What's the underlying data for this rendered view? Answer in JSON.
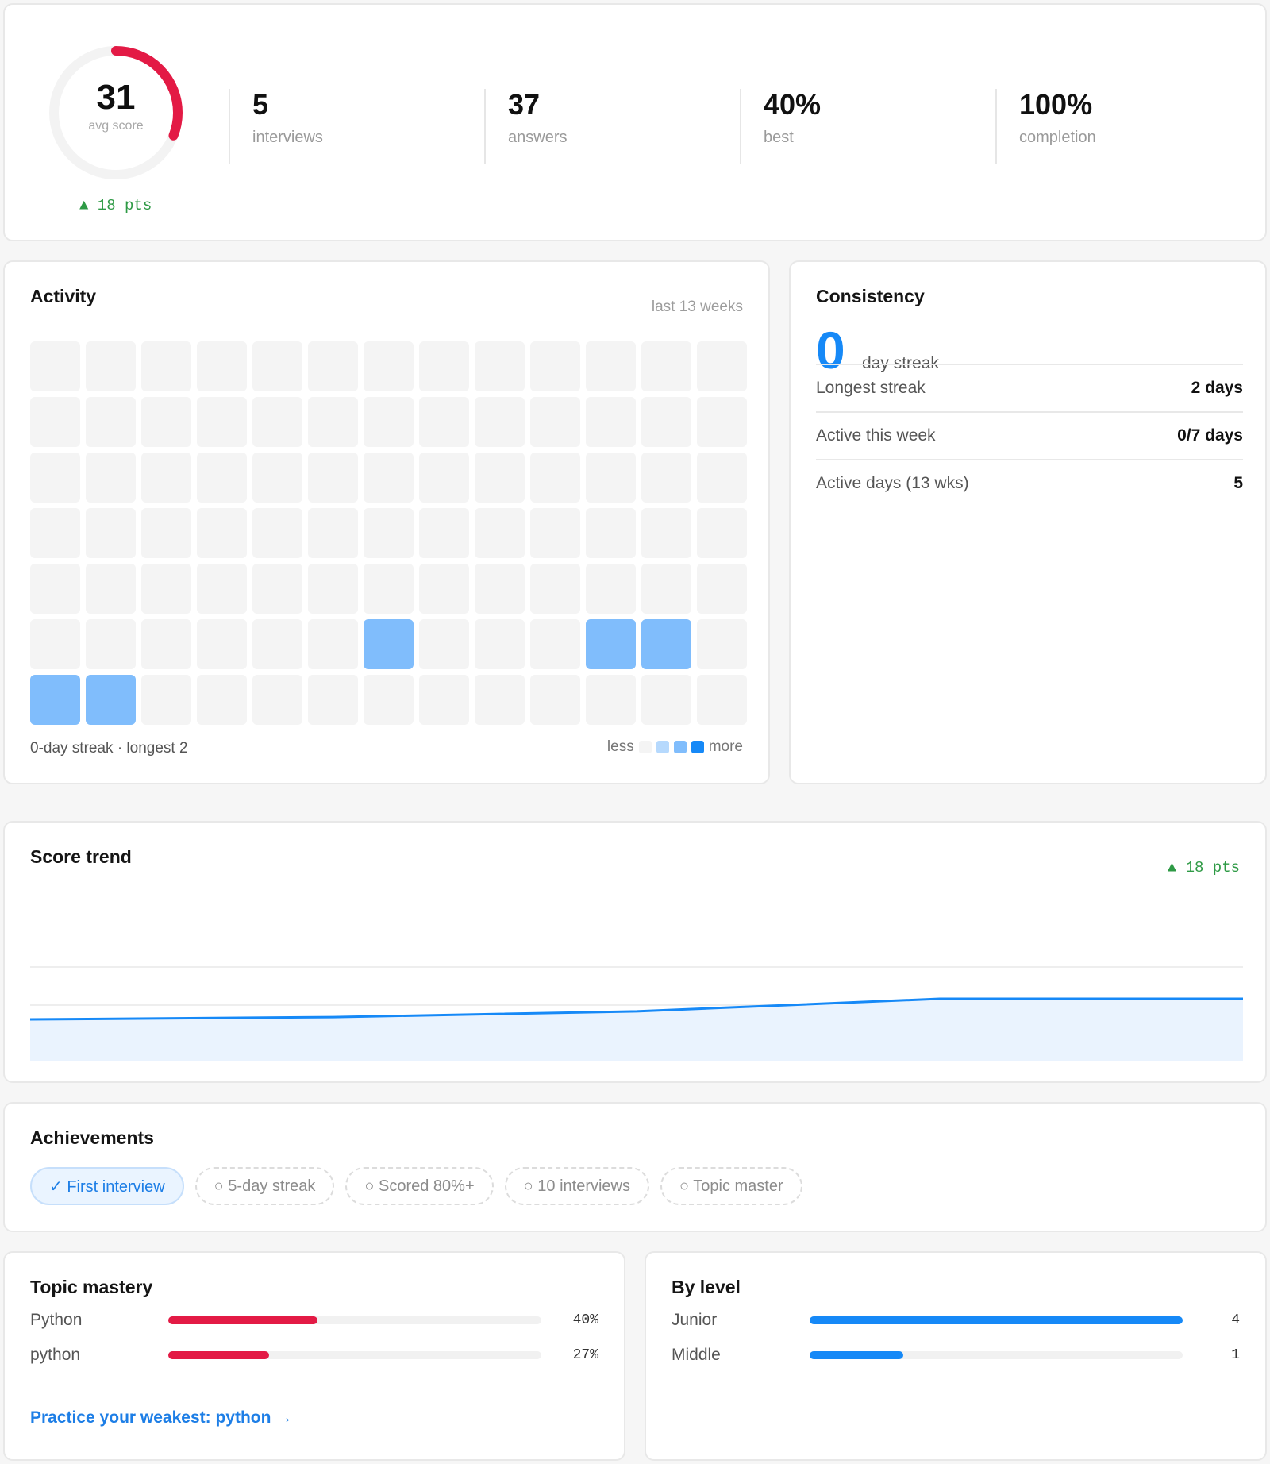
{
  "summary": {
    "avg_score": "31",
    "avg_score_caption": "avg score",
    "avg_score_fraction": 0.31,
    "delta": "▲ 18 pts",
    "stats": [
      {
        "value": "5",
        "label": "interviews"
      },
      {
        "value": "37",
        "label": "answers"
      },
      {
        "value": "40%",
        "label": "best"
      },
      {
        "value": "100%",
        "label": "completion"
      }
    ]
  },
  "activity": {
    "title": "Activity",
    "range": "last 13 weeks",
    "weeks": 13,
    "days": 7,
    "active_cells": [
      [
        5,
        6
      ],
      [
        5,
        10
      ],
      [
        5,
        11
      ],
      [
        6,
        0
      ],
      [
        6,
        1
      ]
    ],
    "footer": "0-day streak · longest 2",
    "legend_less": "less",
    "legend_more": "more",
    "legend_colors": [
      "#f4f4f4",
      "#b6d9fd",
      "#80bdfc",
      "#1689f7"
    ]
  },
  "consistency": {
    "title": "Consistency",
    "current_streak": "0",
    "current_streak_label": "day streak",
    "rows": [
      {
        "label": "Longest streak",
        "value": "2 days"
      },
      {
        "label": "Active this week",
        "value": "0/7 days"
      },
      {
        "label": "Active days (13 wks)",
        "value": "5"
      }
    ]
  },
  "score_trend": {
    "title": "Score trend",
    "delta": "▲ 18 pts",
    "points": [
      20,
      22,
      27,
      38,
      38
    ]
  },
  "achievements": {
    "title": "Achievements",
    "items": [
      {
        "label": "✓ First interview",
        "earned": true
      },
      {
        "label": "○ 5-day streak",
        "earned": false
      },
      {
        "label": "○ Scored 80%+",
        "earned": false
      },
      {
        "label": "○ 10 interviews",
        "earned": false
      },
      {
        "label": "○ Topic master",
        "earned": false
      }
    ]
  },
  "topic_mastery": {
    "title": "Topic mastery",
    "bar_color": "#e31a45",
    "rows": [
      {
        "label": "Python",
        "value": "40%",
        "fraction": 0.4
      },
      {
        "label": "python",
        "value": "27%",
        "fraction": 0.27
      }
    ],
    "link": "Practice your weakest: python →"
  },
  "by_level": {
    "title": "By level",
    "bar_color": "#1689f7",
    "rows": [
      {
        "label": "Junior",
        "value": "4",
        "fraction": 1.0
      },
      {
        "label": "Middle",
        "value": "1",
        "fraction": 0.25
      }
    ]
  },
  "colors": {
    "accent": "#1689f7",
    "ring": "#e31a45",
    "positive": "#2e9a45",
    "heat_active": "#80bdfc"
  }
}
